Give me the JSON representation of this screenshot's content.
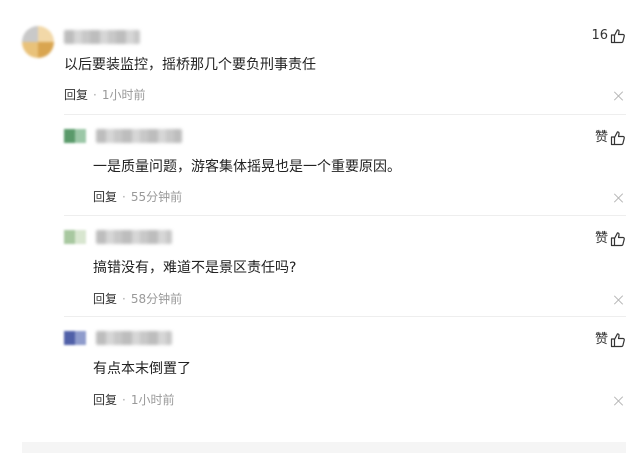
{
  "comments": [
    {
      "text": "以后要装监控，摇桥那几个要负刑事责任",
      "reply_label": "回复",
      "time": "1小时前",
      "likes": "16",
      "avatar_colors": [
        "#e9c27a",
        "#d9a550",
        "#f2d8a8",
        "#c9c9c9"
      ]
    }
  ],
  "replies": [
    {
      "text": "一是质量问题，游客集体摇晃也是一个重要原因。",
      "reply_label": "回复",
      "time": "55分钟前",
      "like_label": "赞",
      "avatar_colors": [
        "#5a9a6a",
        "#9cc7a7"
      ]
    },
    {
      "text": "搞错没有，难道不是景区责任吗?",
      "reply_label": "回复",
      "time": "58分钟前",
      "like_label": "赞",
      "avatar_colors": [
        "#a8c8a0",
        "#d8e6d0"
      ]
    },
    {
      "text": "有点本末倒置了",
      "reply_label": "回复",
      "time": "1小时前",
      "like_label": "赞",
      "avatar_colors": [
        "#5060a8",
        "#8f9ccc"
      ]
    }
  ],
  "separator": "·"
}
